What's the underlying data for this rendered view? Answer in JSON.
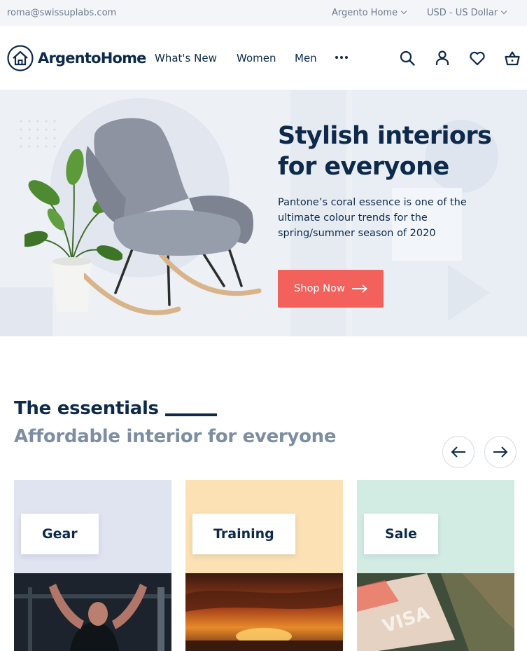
{
  "topbar": {
    "email": "roma@swissuplabs.com",
    "store_switcher": "Argento Home",
    "currency_switcher": "USD - US Dollar"
  },
  "header": {
    "logo_text": "ArgentoHome",
    "nav": [
      "What's New",
      "Women",
      "Men"
    ],
    "more_icon": "more-dots-icon",
    "icons": [
      "search-icon",
      "account-icon",
      "wishlist-heart-icon",
      "cart-basket-icon"
    ]
  },
  "hero": {
    "title_line1": "Stylish interiors",
    "title_line2": "for everyone",
    "text": "Pantone’s coral essence is one of the ultimate colour trends for the spring/summer season of 2020",
    "cta_label": "Shop Now",
    "cta_color": "#f2615b",
    "background": "#edf1f6"
  },
  "essentials": {
    "title": "The essentials",
    "subtitle": "Affordable interior for everyone",
    "prev_icon": "arrow-left-icon",
    "next_icon": "arrow-right-icon",
    "cards": [
      {
        "label": "Gear",
        "color": "#e0e3f0"
      },
      {
        "label": "Training",
        "color": "#fbe1b4"
      },
      {
        "label": "Sale",
        "color": "#d2ece4"
      }
    ]
  },
  "colors": {
    "primary": "#0d2a4b",
    "muted": "#7d8ea3",
    "accent": "#f2615b"
  }
}
